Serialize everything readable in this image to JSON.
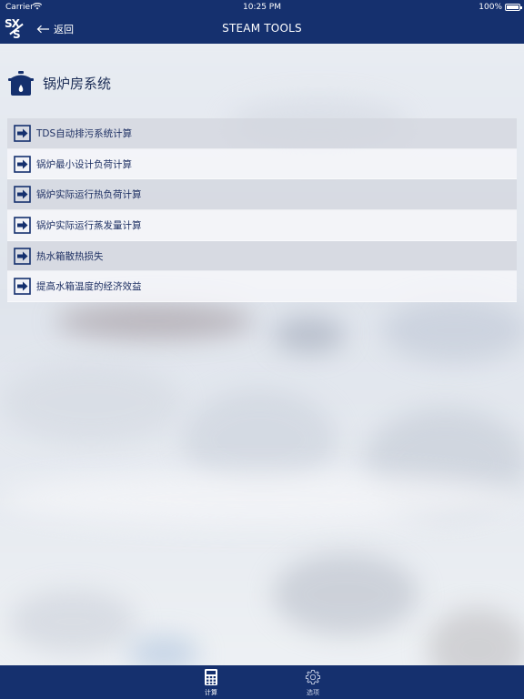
{
  "status_bar": {
    "carrier": "Carrier",
    "time": "10:25 PM",
    "battery": "100%"
  },
  "nav": {
    "logo_top": "SX",
    "logo_bottom": "S",
    "back_label": "返回",
    "title": "STEAM TOOLS"
  },
  "section": {
    "title": "锅炉房系统",
    "icon": "boiler-pot-icon"
  },
  "menu": {
    "items": [
      {
        "label": "TDS自动排污系统计算"
      },
      {
        "label": "锅炉最小设计负荷计算"
      },
      {
        "label": "锅炉实际运行热负荷计算"
      },
      {
        "label": "锅炉实际运行蒸发量计算"
      },
      {
        "label": "热水箱散热损失"
      },
      {
        "label": "提高水箱温度的经济效益"
      }
    ]
  },
  "tabs": {
    "calc": {
      "label": "计算",
      "icon": "calculator-icon"
    },
    "options": {
      "label": "选项",
      "icon": "gear-icon"
    }
  },
  "colors": {
    "brand_blue": "#15306e",
    "text_blue": "#1e3063"
  }
}
